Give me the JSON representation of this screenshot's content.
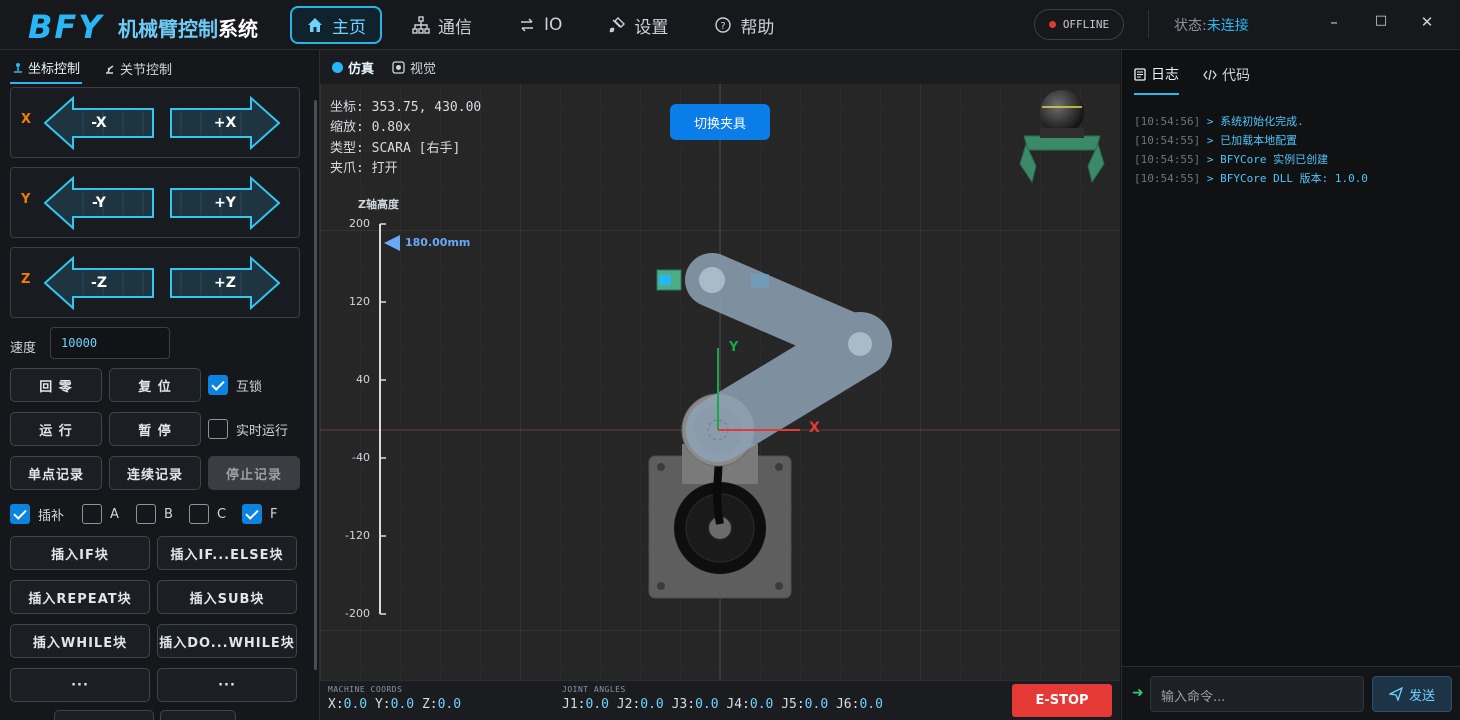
{
  "header": {
    "logo": "BFY",
    "title_main": "机械臂控制",
    "title_suffix": "系统",
    "nav": [
      {
        "label": "主页",
        "icon": "home-icon"
      },
      {
        "label": "通信",
        "icon": "network-icon"
      },
      {
        "label": "IO",
        "icon": "swap-icon"
      },
      {
        "label": "设置",
        "icon": "settings-icon"
      },
      {
        "label": "帮助",
        "icon": "help-icon"
      }
    ],
    "connection_badge": "OFFLINE",
    "status_label": "状态:",
    "status_value": "未连接",
    "window_buttons": [
      "–",
      "□",
      "✕"
    ]
  },
  "left_panel": {
    "tabs": [
      "坐标控制",
      "关节控制"
    ],
    "axes": [
      {
        "name": "X",
        "minus": "-X",
        "plus": "+X"
      },
      {
        "name": "Y",
        "minus": "-Y",
        "plus": "+Y"
      },
      {
        "name": "Z",
        "minus": "-Z",
        "plus": "+Z"
      }
    ],
    "speed_label": "速度",
    "speed_value": "10000",
    "buttons": {
      "home": "回 零",
      "reset": "复 位",
      "run": "运 行",
      "pause": "暂 停",
      "single_record": "单点记录",
      "continuous_record": "连续记录",
      "stop_record": "停止记录"
    },
    "interlock": {
      "label": "互锁",
      "checked": true
    },
    "realtime_run": {
      "label": "实时运行",
      "checked": false
    },
    "interp_checks": [
      {
        "label": "插补",
        "checked": true
      },
      {
        "label": "A",
        "checked": false
      },
      {
        "label": "B",
        "checked": false
      },
      {
        "label": "C",
        "checked": false
      },
      {
        "label": "F",
        "checked": true
      }
    ],
    "insert_blocks": [
      "插入IF块",
      "插入IF...ELSE块",
      "插入REPEAT块",
      "插入SUB块",
      "插入WHILE块",
      "插入DO...WHILE块",
      "···",
      "···"
    ]
  },
  "center_panel": {
    "tabs": [
      "仿真",
      "视觉"
    ],
    "info": {
      "coords": "坐标: 353.75, 430.00",
      "zoom": "缩放: 0.80x",
      "type": "类型: SCARA [右手]",
      "gripper": "夹爪: 打开"
    },
    "swap_tool_button": "切换夹具",
    "z_axis": {
      "title": "Z轴高度",
      "ticks": [
        "200",
        "120",
        "40",
        "-40",
        "-120",
        "-200"
      ],
      "marker": "180.00mm",
      "marker_value": 180,
      "range": [
        -200,
        200
      ]
    },
    "axis_labels": {
      "x": "X",
      "y": "Y"
    },
    "footer": {
      "machine_label": "MACHINE COORDS",
      "machine": [
        {
          "k": "X:",
          "v": "0.0"
        },
        {
          "k": "Y:",
          "v": "0.0"
        },
        {
          "k": "Z:",
          "v": "0.0"
        }
      ],
      "joint_label": "JOINT ANGLES",
      "joints": [
        {
          "k": "J1:",
          "v": "0.0"
        },
        {
          "k": "J2:",
          "v": "0.0"
        },
        {
          "k": "J3:",
          "v": "0.0"
        },
        {
          "k": "J4:",
          "v": "0.0"
        },
        {
          "k": "J5:",
          "v": "0.0"
        },
        {
          "k": "J6:",
          "v": "0.0"
        }
      ],
      "estop": "E-STOP"
    }
  },
  "right_panel": {
    "tabs": [
      "日志",
      "代码"
    ],
    "logs": [
      {
        "time": "[10:54:56]",
        "msg": "> 系统初始化完成."
      },
      {
        "time": "[10:54:55]",
        "msg": "> 已加载本地配置"
      },
      {
        "time": "[10:54:55]",
        "msg": "> BFYCore 实例已创建"
      },
      {
        "time": "[10:54:55]",
        "msg": "> BFYCore DLL 版本: 1.0.0"
      }
    ],
    "command_placeholder": "输入命令...",
    "send_label": "发送"
  },
  "colors": {
    "accent": "#29b6f6",
    "estop": "#e53935",
    "primary_button": "#0b7de8",
    "axis_label": "#f57c00"
  }
}
